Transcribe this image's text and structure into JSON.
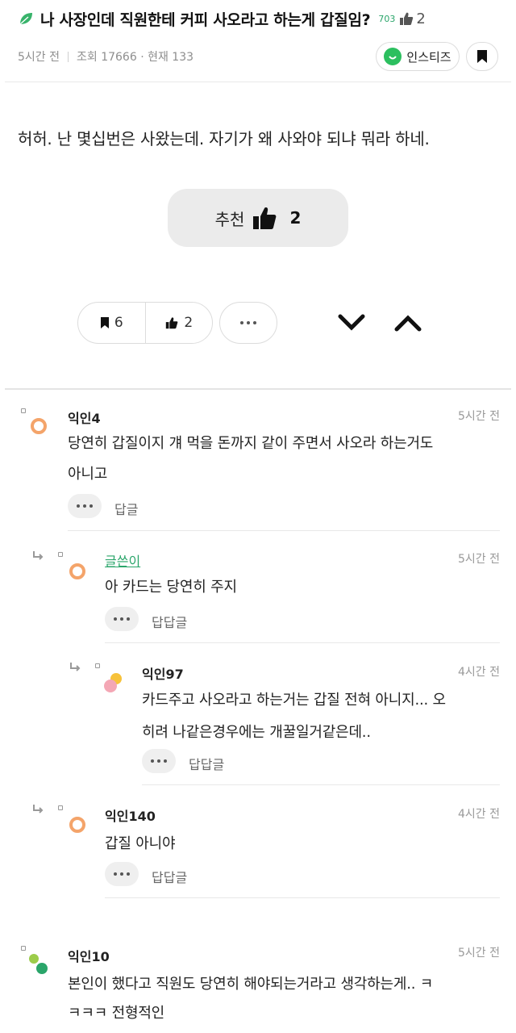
{
  "post": {
    "title": "나 사장인데 직원한테 커피 사오라고 하는게 갑질임?",
    "view_badge": "703",
    "like_count": "2",
    "time": "5시간 전",
    "views": "조회 17666 · 현재 133",
    "board_label": "인스티즈",
    "body": "허허. 난 몇십번은 사왔는데. 자기가 왜 사와야 되냐 뭐라 하네.",
    "recommend_label": "추천",
    "recommend_count": "2",
    "bookmark_count": "6",
    "like_count_pill": "2"
  },
  "colors": {
    "accent": "#2aa56a",
    "avatar_orange": "#f4a46a",
    "brand_green": "#2cbf5f"
  },
  "comments": [
    {
      "name": "익인4",
      "time": "5시간 전",
      "text_l1": "당연히 갑질이지 걔 먹을 돈까지 같이 주면서 사오라 하는거도",
      "text_l2": "아니고",
      "reply_label": "답글"
    },
    {
      "name": "글쓴이",
      "time": "5시간 전",
      "text_l1": "아 카드는 당연히 주지",
      "reply_label": "답답글"
    },
    {
      "name": "익인97",
      "time": "4시간 전",
      "text_l1": "카드주고 사오라고 하는거는 갑질 전혀 아니지... 오",
      "text_l2": "히려 나같은경우에는 개꿀일거같은데..",
      "reply_label": "답답글"
    },
    {
      "name": "익인140",
      "time": "4시간 전",
      "text_l1": "갑질 아니야",
      "reply_label": "답답글"
    },
    {
      "name": "익인10",
      "time": "5시간 전",
      "text_l1": "본인이 했다고 직원도 당연히 해야되는거라고 생각하는게.. ㅋ",
      "text_l2": "ㅋㅋㅋ 전형적인"
    }
  ]
}
